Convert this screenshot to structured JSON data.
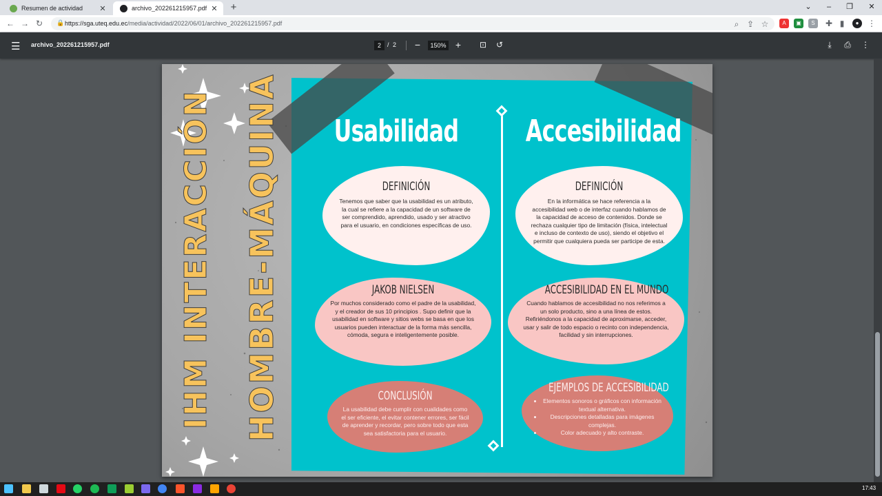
{
  "tabs": [
    {
      "title": "Resumen de actividad",
      "close": "✕"
    },
    {
      "title": "archivo_202261215957.pdf",
      "close": "✕"
    }
  ],
  "new_tab": "+",
  "window_controls": {
    "chevron": "⌄",
    "minimize": "–",
    "restore": "❐",
    "close": "✕"
  },
  "address": {
    "host": "https://sga.uteq.edu.ec",
    "path": "/media/actividad/2022/06/01/archivo_202261215957.pdf"
  },
  "pdf_toolbar": {
    "filename": "archivo_202261215957.pdf",
    "current_page": "2",
    "page_separator": "/",
    "total_pages": "2",
    "zoom": "150%"
  },
  "poster": {
    "vertical_title_1": "IHM INTERACCIÓN",
    "vertical_title_2": "HOMBRE-MÁQUINA",
    "col_left_title": "Usabilidad",
    "col_right_title": "Accesibilidad",
    "left": {
      "def_heading": "DEFINICIÓN",
      "def_text": "Tenemos que saber que la usabilidad es un atributo, la cual se refiere a la capacidad de un software de ser comprendido, aprendido, usado y ser atractivo para el usuario, en condiciones específicas de uso.",
      "jakob_heading": "JAKOB NIELSEN",
      "jakob_text": "Por muchos considerado como el padre de la usabilidad, y el creador de sus 10 principios . Supo definir que la usabilidad en software y sitios webs  se basa en que los usuarios pueden interactuar de la forma más sencilla, cómoda, segura e inteligentemente posible.",
      "concl_heading": "CONCLUSIÓN",
      "concl_text": "La usabilidad debe cumplir con cualidades como el ser eficiente, el evitar contener errores, ser fácil de aprender y recordar, pero sobre todo que esta sea satisfactoria para el usuario."
    },
    "right": {
      "def_heading": "DEFINICIÓN",
      "def_text": "En la informática se hace referencia a la accesibilidad web o de interfaz cuando hablamos de la capacidad de acceso de contenidos. Donde se rechaza cualquier tipo de limitación (física, intelectual e incluso de contexto de uso), siendo el objetivo el permitir que cualquiera pueda ser participe de esta.",
      "world_heading": "ACCESIBILIDAD EN EL MUNDO",
      "world_text": "Cuando hablamos de accesibilidad no nos referimos a un solo producto, sino a una línea de estos. Refiriéndonos a la capacidad de aproximarse, acceder, usar y salir de todo espacio o recinto con independencia, facilidad y sin interrupciones.",
      "examples_heading": "EJEMPLOS DE ACCESIBILIDAD",
      "examples": [
        "Elementos sonoros o gráficos con información textual alternativa.",
        "Descripciones detalladas para imágenes complejas.",
        "Color adecuado y alto contraste."
      ]
    }
  },
  "clock": "17:43",
  "colors": {
    "card": "#00c2cc",
    "title_yellow": "#f7c35c",
    "blob_light": "#fff0ee",
    "blob_pink": "#f9c6c4",
    "blob_coral": "#d67f76"
  }
}
